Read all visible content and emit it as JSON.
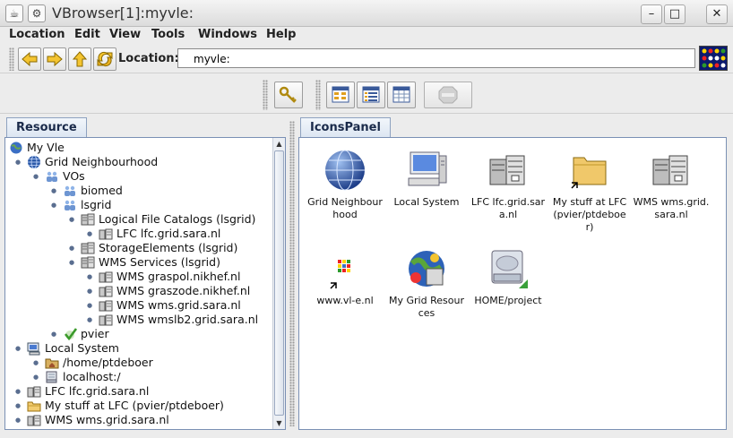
{
  "window": {
    "title": "VBrowser[1]:myvle:"
  },
  "menu": [
    "Location",
    "Edit",
    "View",
    "Tools",
    "Windows",
    "Help"
  ],
  "location": {
    "label": "Location:",
    "value": "myvle:"
  },
  "tabs": {
    "left": "Resource",
    "right": "IconsPanel"
  },
  "tree": [
    {
      "label": "My Vle",
      "icon": "globe-small-icon",
      "level": 0
    },
    {
      "label": "Grid Neighbourhood",
      "icon": "globe-icon",
      "level": 1
    },
    {
      "label": "VOs",
      "icon": "people-group-icon",
      "level": 2
    },
    {
      "label": "biomed",
      "icon": "people-group-icon",
      "level": 3
    },
    {
      "label": "lsgrid",
      "icon": "people-group-icon",
      "level": 3
    },
    {
      "label": "Logical File Catalogs (lsgrid)",
      "icon": "servers-icon",
      "level": 4
    },
    {
      "label": "LFC lfc.grid.sara.nl",
      "icon": "server-icon",
      "level": 5
    },
    {
      "label": "StorageElements (lsgrid)",
      "icon": "servers-icon",
      "level": 4
    },
    {
      "label": "WMS Services (lsgrid)",
      "icon": "servers-icon",
      "level": 4
    },
    {
      "label": "WMS graspol.nikhef.nl",
      "icon": "server-icon",
      "level": 5
    },
    {
      "label": "WMS graszode.nikhef.nl",
      "icon": "server-icon",
      "level": 5
    },
    {
      "label": "WMS wms.grid.sara.nl",
      "icon": "server-icon",
      "level": 5
    },
    {
      "label": "WMS wmslb2.grid.sara.nl",
      "icon": "server-icon",
      "level": 5
    },
    {
      "label": "pvier",
      "icon": "checkmark-icon",
      "level": 3
    },
    {
      "label": "Local System",
      "icon": "computer-icon",
      "level": 1
    },
    {
      "label": "/home/ptdeboer",
      "icon": "home-folder-icon",
      "level": 2
    },
    {
      "label": "localhost:/",
      "icon": "drive-icon",
      "level": 2
    },
    {
      "label": "LFC lfc.grid.sara.nl",
      "icon": "server-icon",
      "level": 1
    },
    {
      "label": "My stuff at LFC (pvier/ptdeboer)",
      "icon": "folder-icon",
      "level": 1
    },
    {
      "label": "WMS wms.grid.sara.nl",
      "icon": "server-icon",
      "level": 1
    }
  ],
  "icons": [
    {
      "label": "Grid Neighbourhood",
      "icon": "globe-icon"
    },
    {
      "label": "Local System",
      "icon": "computer-icon"
    },
    {
      "label": "LFC lfc.grid.sara.nl",
      "icon": "servers-icon"
    },
    {
      "label": "My stuff at LFC (pvier/ptdeboer)",
      "icon": "folder-link-icon"
    },
    {
      "label": "WMS wms.grid.sara.nl",
      "icon": "servers-icon"
    },
    {
      "label": "www.vl-e.nl",
      "icon": "vle-logo-link-icon"
    },
    {
      "label": "My Grid Resources",
      "icon": "grid-resources-icon"
    },
    {
      "label": "HOME/project",
      "icon": "hard-drive-icon"
    }
  ]
}
